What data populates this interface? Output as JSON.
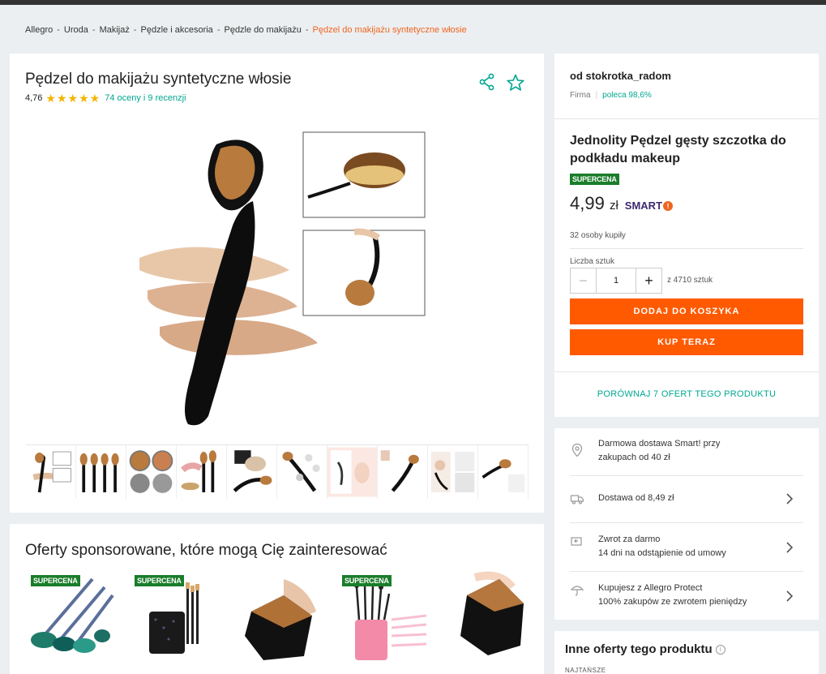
{
  "breadcrumb": {
    "items": [
      "Allegro",
      "Uroda",
      "Makijaż",
      "Pędzle i akcesoria",
      "Pędzle do makijażu"
    ],
    "separator": "-",
    "current": "Pędzel do makijażu syntetyczne włosie"
  },
  "product": {
    "title": "Pędzel do makijażu syntetyczne włosie",
    "rating": "4,76",
    "stars": 5,
    "reviews_link": "74 oceny i 9 recenzji"
  },
  "sponsored": {
    "title": "Oferty sponsorowane, które mogą Cię zainteresować",
    "badge": "SUPERCENA"
  },
  "seller": {
    "name": "od stokrotka_radom",
    "type": "Firma",
    "recommend": "poleca 98,6%"
  },
  "offer": {
    "title": "Jednolity Pędzel gęsty szczotka do podkładu makeup",
    "badge": "SUPERCENA",
    "price_main": "4,99",
    "price_currency": "zł",
    "smart_label": "SMART",
    "bought": "32 osoby kupiły",
    "qty_label": "Liczba sztuk",
    "qty_value": "1",
    "qty_available": "z 4710 sztuk",
    "add_to_cart": "DODAJ DO KOSZYKA",
    "buy_now": "KUP TERAZ",
    "compare": "PORÓWNAJ 7 OFERT TEGO PRODUKTU"
  },
  "delivery": {
    "free_line1": "Darmowa dostawa Smart! przy",
    "free_line2": "zakupach od 40 zł",
    "shipping": "Dostawa od 8,49 zł",
    "return_line1": "Zwrot za darmo",
    "return_line2": "14 dni na odstąpienie od umowy",
    "protect_line1": "Kupujesz z Allegro Protect",
    "protect_line2": "100% zakupów ze zwrotem pieniędzy"
  },
  "other_offers": {
    "title": "Inne oferty tego produktu",
    "sort_label": "NAJTAŃSZE"
  },
  "colors": {
    "accent_orange": "#ff5a00",
    "link_teal": "#00a790",
    "badge_green": "#1a7d2a",
    "breadcrumb_current": "#f0641e"
  }
}
